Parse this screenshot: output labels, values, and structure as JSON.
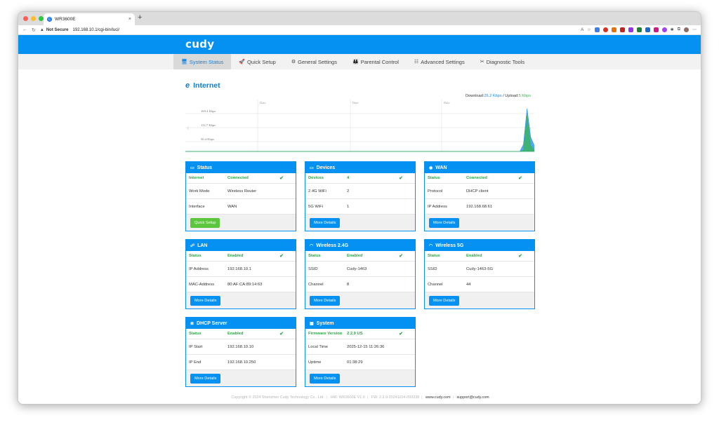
{
  "browser": {
    "tab_title": "WR3600E",
    "favicon_letter": "C",
    "tab_close": "×",
    "new_tab": "+",
    "security": "Not Secure",
    "url": "192.168.10.1/cgi-bin/luci/"
  },
  "brand": {
    "logo": "cudy"
  },
  "nav": [
    {
      "label": "System Status",
      "icon": "monitor-icon",
      "glyph": "🖥"
    },
    {
      "label": "Quick Setup",
      "icon": "rocket-icon",
      "glyph": "🚀"
    },
    {
      "label": "General Settings",
      "icon": "gear-icon",
      "glyph": "⚙"
    },
    {
      "label": "Parental Control",
      "icon": "people-icon",
      "glyph": "👪"
    },
    {
      "label": "Advanced Settings",
      "icon": "sliders-icon",
      "glyph": "☷"
    },
    {
      "label": "Diagnostic Tools",
      "icon": "tools-icon",
      "glyph": "✂"
    }
  ],
  "internet": {
    "title": "Internet",
    "download_label": "Download:",
    "download_value": "26.2 Kbps",
    "upload_label": "/ Upload:",
    "upload_value": "5 Kbps"
  },
  "chart_data": {
    "type": "area",
    "title": "",
    "xlabel": "",
    "ylabel": "",
    "y_ticks": [
      "169.4 Kbps",
      "112.7 Kbps",
      "56.4 Kbps"
    ],
    "column_labels": [
      "Date",
      "Date",
      "Date"
    ],
    "series": [
      {
        "name": "",
        "color": "#1a8df0",
        "values": [
          0,
          0,
          0,
          0,
          0,
          0,
          0,
          0,
          0,
          0,
          0,
          0,
          0,
          0,
          0,
          0,
          0,
          0,
          0,
          0,
          0,
          0,
          0,
          0,
          0,
          0,
          0,
          0,
          0,
          0,
          0,
          0,
          0,
          0,
          0,
          0,
          0,
          0,
          0,
          0,
          0,
          0,
          0,
          0,
          0,
          0,
          0,
          0,
          0,
          0,
          0,
          0,
          0,
          0,
          0,
          0,
          0,
          0,
          0,
          0,
          0,
          0,
          0,
          0,
          0,
          0,
          0,
          0,
          0,
          0,
          0,
          0,
          0,
          0,
          0,
          0,
          0,
          0,
          0,
          0,
          0,
          0,
          0,
          0,
          0,
          0,
          0,
          0,
          0,
          0,
          0,
          0,
          0,
          30,
          180,
          60,
          25
        ]
      },
      {
        "name": "",
        "color": "#35b44a",
        "values": [
          0,
          0,
          0,
          0,
          0,
          0,
          0,
          0,
          0,
          0,
          0,
          0,
          0,
          0,
          0,
          0,
          0,
          0,
          0,
          0,
          0,
          0,
          0,
          0,
          0,
          0,
          0,
          0,
          0,
          0,
          0,
          0,
          0,
          0,
          0,
          0,
          0,
          0,
          0,
          0,
          0,
          0,
          0,
          0,
          0,
          0,
          0,
          0,
          0,
          0,
          0,
          0,
          0,
          0,
          0,
          0,
          0,
          0,
          0,
          0,
          0,
          0,
          0,
          0,
          0,
          0,
          0,
          0,
          0,
          0,
          0,
          0,
          0,
          0,
          0,
          0,
          0,
          0,
          0,
          0,
          0,
          0,
          0,
          0,
          0,
          0,
          0,
          0,
          0,
          0,
          0,
          0,
          0,
          5,
          150,
          25,
          5
        ]
      }
    ],
    "ylim": [
      0,
      200
    ],
    "grid": true
  },
  "cards": {
    "status": {
      "title": "Status",
      "icon": "status-icon",
      "rows": [
        {
          "k": "Internet",
          "v": "Connected",
          "check": true
        },
        {
          "k": "Work Mode",
          "v": "Wireless Router"
        },
        {
          "k": "Interface",
          "v": "WAN"
        }
      ],
      "button": "Quick Setup"
    },
    "devices": {
      "title": "Devices",
      "icon": "devices-icon",
      "rows": [
        {
          "k": "Devices",
          "v": "4",
          "check": true
        },
        {
          "k": "2.4G WiFi",
          "v": "2"
        },
        {
          "k": "5G WiFi",
          "v": "1"
        }
      ],
      "button": "More Details"
    },
    "wan": {
      "title": "WAN",
      "icon": "globe-icon",
      "rows": [
        {
          "k": "Status",
          "v": "Connected",
          "check": true
        },
        {
          "k": "Protocol",
          "v": "DHCP client"
        },
        {
          "k": "IP Address",
          "v": "192.168.68.61"
        }
      ],
      "button": "More Details"
    },
    "lan": {
      "title": "LAN",
      "icon": "network-icon",
      "rows": [
        {
          "k": "Status",
          "v": "Enabled",
          "check": true
        },
        {
          "k": "IP Address",
          "v": "192.168.10.1"
        },
        {
          "k": "MAC-Address",
          "v": "80:AF:CA:89:14:63"
        }
      ],
      "button": "More Details"
    },
    "wireless24": {
      "title": "Wireless 2.4G",
      "icon": "wifi-icon",
      "rows": [
        {
          "k": "Status",
          "v": "Enabled",
          "check": true
        },
        {
          "k": "SSID",
          "v": "Cudy-1463"
        },
        {
          "k": "Channel",
          "v": "8"
        }
      ],
      "button": "More Details"
    },
    "wireless5": {
      "title": "Wireless 5G",
      "icon": "wifi-icon",
      "rows": [
        {
          "k": "Status",
          "v": "Enabled",
          "check": true
        },
        {
          "k": "SSID",
          "v": "Cudy-1463-5G"
        },
        {
          "k": "Channel",
          "v": "44"
        }
      ],
      "button": "More Details"
    },
    "dhcp": {
      "title": "DHCP Server",
      "icon": "server-icon",
      "rows": [
        {
          "k": "Status",
          "v": "Enabled",
          "check": true
        },
        {
          "k": "IP Start",
          "v": "192.168.10.10"
        },
        {
          "k": "IP End",
          "v": "192.168.10.250"
        }
      ],
      "button": "More Details"
    },
    "system": {
      "title": "System",
      "icon": "system-icon",
      "rows": [
        {
          "k": "Firmware Version",
          "v": "2.2.9 US",
          "check": true
        },
        {
          "k": "Local Time",
          "v": "2025-12-15 11:26:36"
        },
        {
          "k": "Uptime",
          "v": "01:38:29"
        }
      ],
      "button": "More Details"
    }
  },
  "footer": {
    "copyright": "Copyright © 2024 Shenzhen Cudy Technology Co., Ltd.",
    "hw": "HW: WR3600E V1.0",
    "fw": "FW: 2.2.9-20241104-093338",
    "site": "www.cudy.com",
    "email": "support@cudy.com"
  },
  "colors": {
    "accent": "#0591f2",
    "ok": "#2aa843",
    "quick_setup": "#5cc63d"
  }
}
